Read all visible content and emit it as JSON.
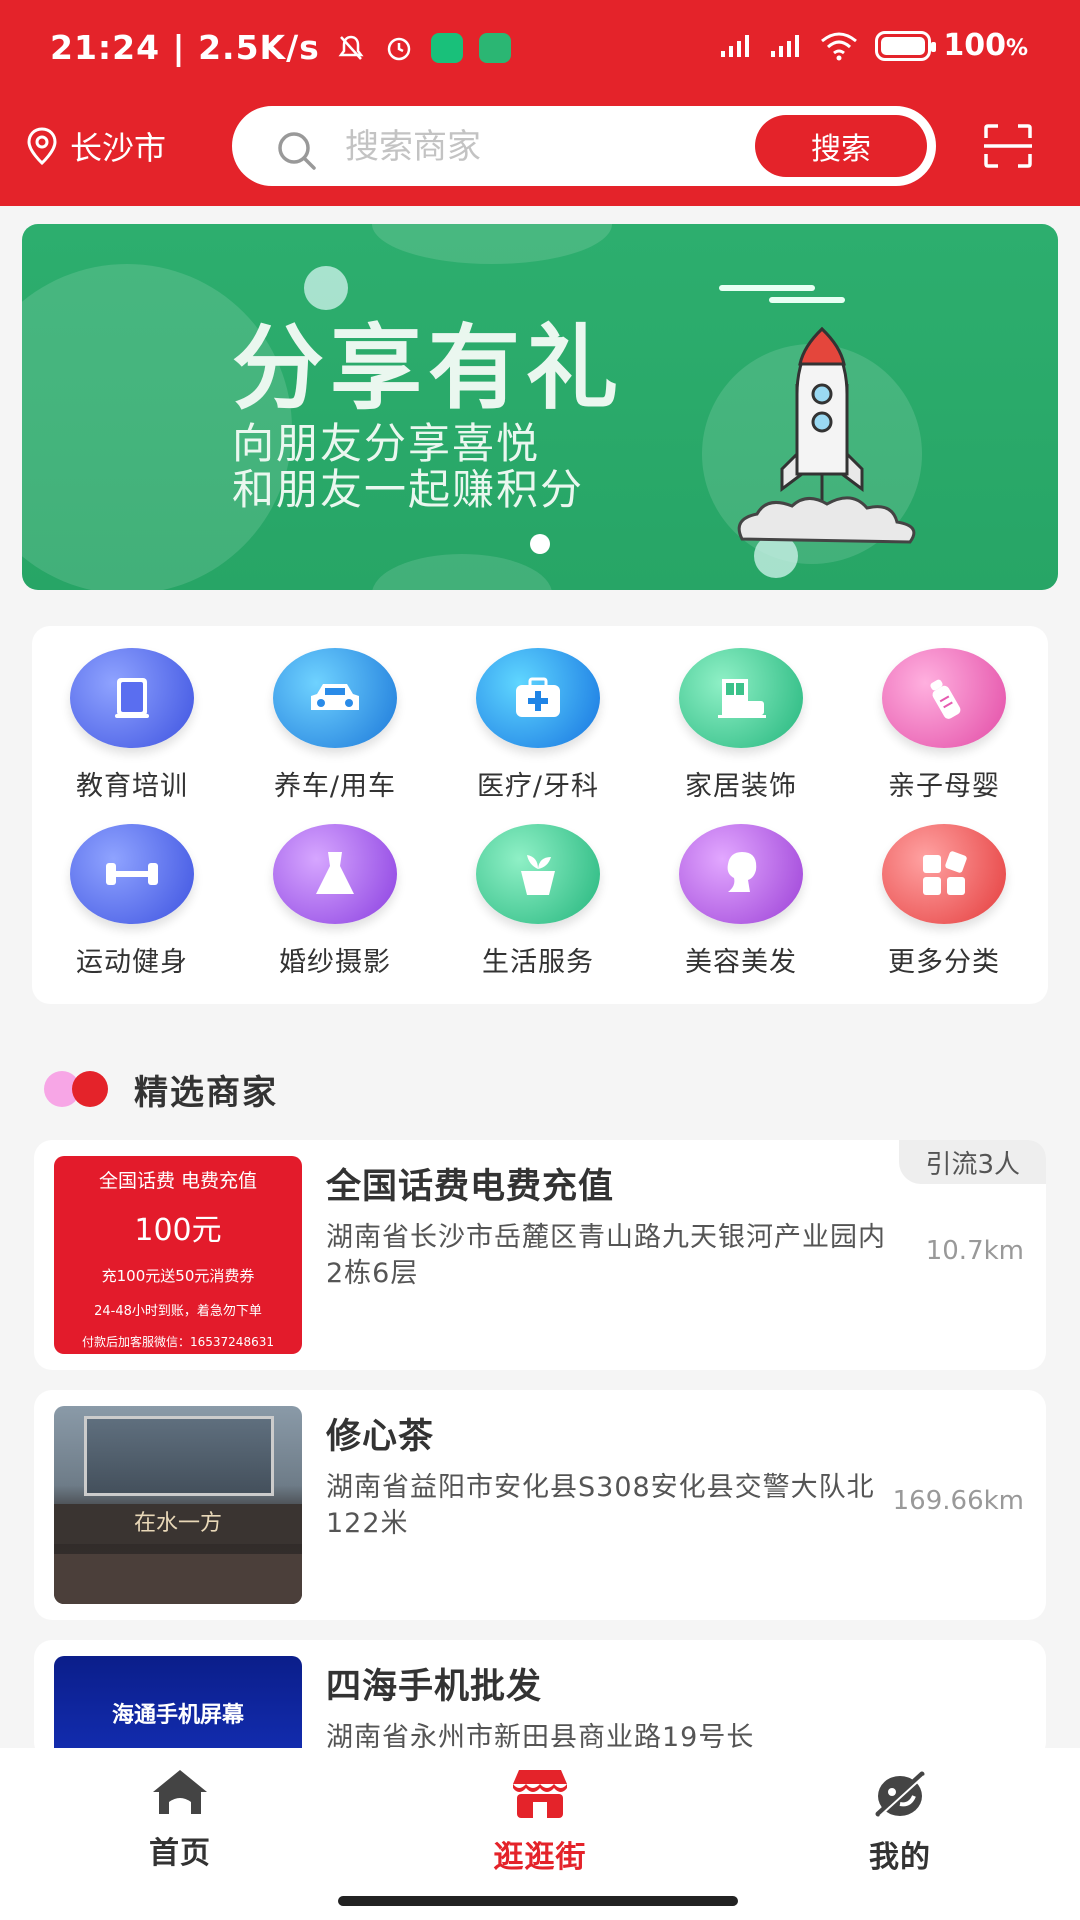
{
  "status_bar": {
    "time": "21:24",
    "speed": "2.5K/s",
    "battery": "100",
    "battery_unit": "%"
  },
  "header": {
    "city": "长沙市",
    "search_placeholder": "搜索商家",
    "search_button": "搜索"
  },
  "banner": {
    "title": "分享有礼",
    "subtitle_line1": "向朋友分享喜悦",
    "subtitle_line2": "和朋友一起赚积分"
  },
  "categories": [
    {
      "label": "教育培训",
      "icon": "book-icon"
    },
    {
      "label": "养车/用车",
      "icon": "car-icon"
    },
    {
      "label": "医疗/牙科",
      "icon": "medical-kit-icon"
    },
    {
      "label": "家居装饰",
      "icon": "furniture-icon"
    },
    {
      "label": "亲子母婴",
      "icon": "baby-bottle-icon"
    },
    {
      "label": "运动健身",
      "icon": "dumbbell-icon"
    },
    {
      "label": "婚纱摄影",
      "icon": "wedding-dress-icon"
    },
    {
      "label": "生活服务",
      "icon": "plant-icon"
    },
    {
      "label": "美容美发",
      "icon": "woman-face-icon"
    },
    {
      "label": "更多分类",
      "icon": "more-categories-icon"
    }
  ],
  "section": {
    "title": "精选商家"
  },
  "merchants": [
    {
      "name": "全国话费电费充值",
      "address": "湖南省长沙市岳麓区青山路九天银河产业园内2栋6层",
      "distance": "10.7km",
      "tag": "引流3人",
      "thumb_lines": [
        "全国话费 电费充值",
        "100元",
        "充100元送50元消费券",
        "24-48小时到账，着急勿下单",
        "付款后加客服微信：16537248631"
      ]
    },
    {
      "name": "修心茶",
      "address": "湖南省益阳市安化县S308安化县交警大队北122米",
      "distance": "169.66km",
      "thumb_lines": [
        "在水一方"
      ]
    },
    {
      "name": "四海手机批发",
      "address": "湖南省永州市新田县商业路19号长",
      "distance": "",
      "thumb_lines": [
        "海通手机屏幕"
      ]
    }
  ],
  "nav": {
    "home": "首页",
    "street": "逛逛街",
    "mine": "我的"
  },
  "colors": {
    "brand_red": "#e4232a",
    "banner_green": "#2dae6e",
    "text_dark": "#333333",
    "text_muted": "#999999"
  }
}
